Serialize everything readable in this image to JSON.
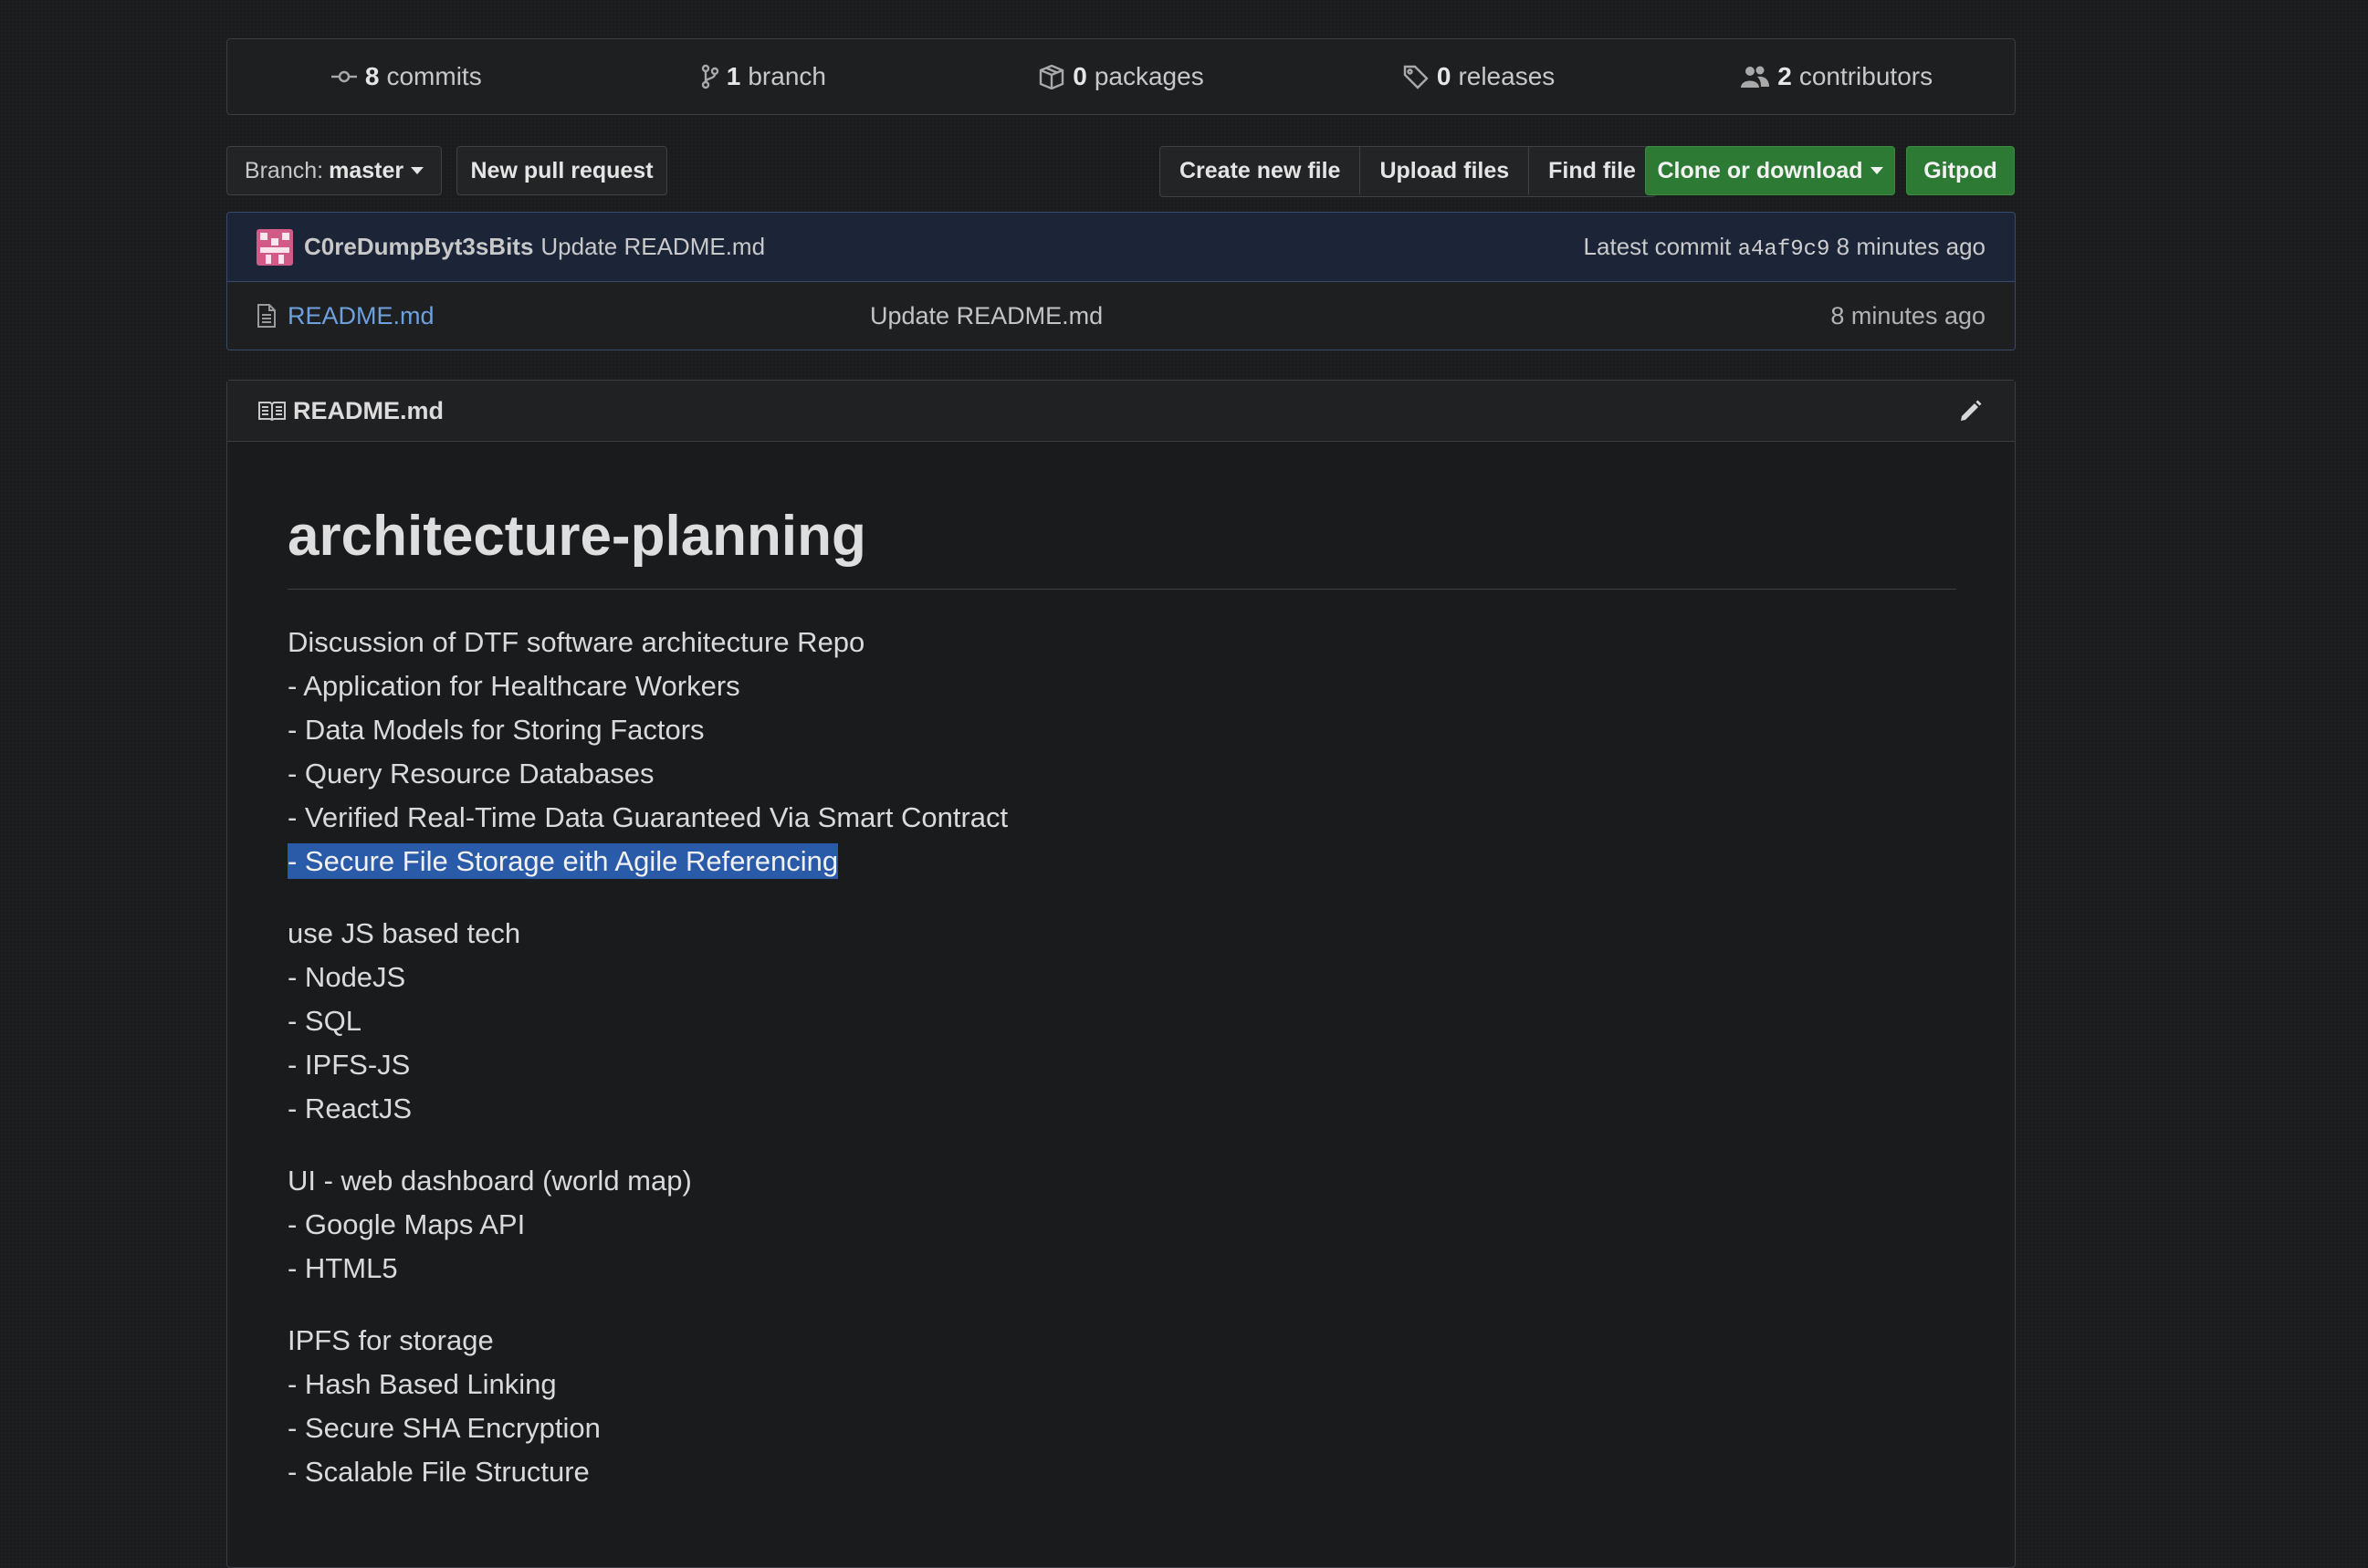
{
  "summary": {
    "commits": {
      "count": "8",
      "label": "commits"
    },
    "branches": {
      "count": "1",
      "label": "branch"
    },
    "packages": {
      "count": "0",
      "label": "packages"
    },
    "releases": {
      "count": "0",
      "label": "releases"
    },
    "contributors": {
      "count": "2",
      "label": "contributors"
    }
  },
  "toolbar": {
    "branch_prefix": "Branch:",
    "branch_name": "master",
    "new_pull_request": "New pull request",
    "create_new_file": "Create new file",
    "upload_files": "Upload files",
    "find_file": "Find file",
    "clone_or_download": "Clone or download",
    "gitpod": "Gitpod"
  },
  "latest_commit": {
    "author": "C0reDumpByt3sBits",
    "message": "Update README.md",
    "label": "Latest commit",
    "sha": "a4af9c9",
    "age": "8 minutes ago"
  },
  "files": [
    {
      "name": "README.md",
      "message": "Update README.md",
      "age": "8 minutes ago"
    }
  ],
  "readme": {
    "filename": "README.md",
    "title": "architecture-planning",
    "paragraphs": [
      {
        "lines": [
          "Discussion of DTF software architecture Repo",
          "- Application for Healthcare Workers",
          "- Data Models for Storing Factors",
          "- Query Resource Databases",
          "- Verified Real-Time Data Guaranteed Via Smart Contract",
          "- Secure File Storage eith Agile Referencing"
        ]
      },
      {
        "lines": [
          "use JS based tech",
          "- NodeJS",
          "- SQL",
          "- IPFS-JS",
          "- ReactJS"
        ]
      },
      {
        "lines": [
          "UI - web dashboard (world map)",
          "- Google Maps API",
          "- HTML5"
        ]
      },
      {
        "lines": [
          "IPFS for storage",
          "- Hash Based Linking",
          "- Secure SHA Encryption",
          "- Scalable File Structure"
        ]
      }
    ]
  },
  "colors": {
    "background": "#1b1c1d",
    "link": "#6ea0dd",
    "green_button": "#2d7a34",
    "selection": "#2a5ba8"
  }
}
